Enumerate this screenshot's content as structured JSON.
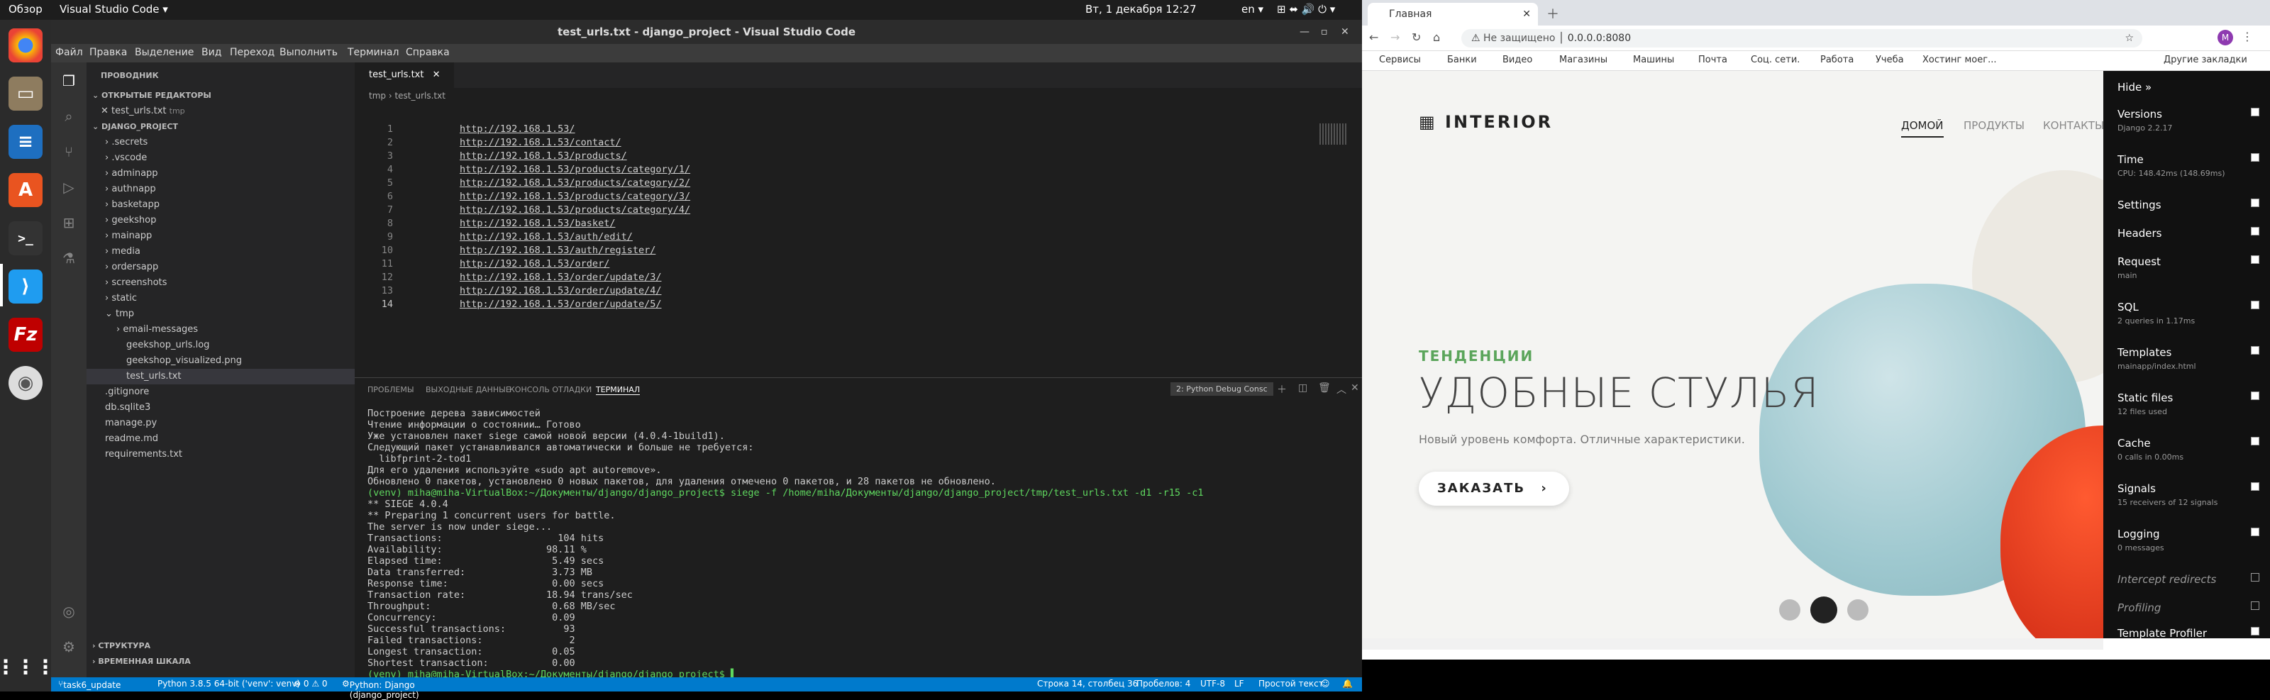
{
  "topbar": {
    "activities": "Обзор",
    "app": "Visual Studio Code ▾",
    "clock": "Вт, 1 декабря  12:27",
    "lang": "en ▾",
    "tray": "⊞ ⬌ 🔊 ⏻ ▾"
  },
  "dock": {
    "icons": [
      "chrome-icon",
      "files-icon",
      "libreoffice-writer-icon",
      "software-center-icon",
      "terminal-icon",
      "vscode-icon",
      "filezilla-icon",
      "disc-icon",
      "apps-grid-icon"
    ]
  },
  "vscode": {
    "title": "test_urls.txt - django_project - Visual Studio Code",
    "menu": [
      "Файл",
      "Правка",
      "Выделение",
      "Вид",
      "Переход",
      "Выполнить",
      "Терминал",
      "Справка"
    ],
    "sidebar": {
      "header": "ПРОВОДНИК",
      "open_editors": "ОТКРЫТЫЕ РЕДАКТОРЫ",
      "open_file": "test_urls.txt",
      "open_file_dir": "tmp",
      "project": "DJANGO_PROJECT",
      "tree": [
        ".secrets",
        ".vscode",
        "adminapp",
        "authnapp",
        "basketapp",
        "geekshop",
        "mainapp",
        "media",
        "ordersapp",
        "screenshots",
        "static",
        "tmp",
        "email-messages",
        "geekshop_urls.log",
        "geekshop_visualized.png",
        "test_urls.txt",
        ".gitignore",
        "db.sqlite3",
        "manage.py",
        "readme.md",
        "requirements.txt"
      ],
      "outline": "СТРУКТУРА",
      "timeline": "ВРЕМЕННАЯ ШКАЛА"
    },
    "tab": "test_urls.txt",
    "breadcrumb": "tmp  ›  test_urls.txt",
    "lines": [
      "http://192.168.1.53/",
      "http://192.168.1.53/contact/",
      "http://192.168.1.53/products/",
      "http://192.168.1.53/products/category/1/",
      "http://192.168.1.53/products/category/2/",
      "http://192.168.1.53/products/category/3/",
      "http://192.168.1.53/products/category/4/",
      "http://192.168.1.53/basket/",
      "http://192.168.1.53/auth/edit/",
      "http://192.168.1.53/auth/register/",
      "http://192.168.1.53/order/",
      "http://192.168.1.53/order/update/3/",
      "http://192.168.1.53/order/update/4/",
      "http://192.168.1.53/order/update/5/"
    ],
    "panel_tabs": [
      "ПРОБЛЕМЫ",
      "ВЫХОДНЫЕ ДАННЫЕ",
      "КОНСОЛЬ ОТЛАДКИ",
      "ТЕРМИНАЛ"
    ],
    "terminal_select": "2: Python Debug Consc",
    "terminal": [
      "Построение дерева зависимостей",
      "Чтение информации о состоянии… Готово",
      "Уже установлен пакет siege самой новой версии (4.0.4-1build1).",
      "Следующий пакет устанавливался автоматически и больше не требуется:",
      "  libfprint-2-tod1",
      "Для его удаления используйте «sudo apt autoremove».",
      "Обновлено 0 пакетов, установлено 0 новых пакетов, для удаления отмечено 0 пакетов, и 28 пакетов не обновлено.",
      "(venv) miha@miha-VirtualBox:~/Документы/django/django_project$ siege -f /home/miha/Документы/django/django_project/tmp/test_urls.txt -d1 -r15 -c1",
      "** SIEGE 4.0.4",
      "** Preparing 1 concurrent users for battle.",
      "The server is now under siege...",
      "Transactions:                    104 hits",
      "Availability:                  98.11 %",
      "Elapsed time:                   5.49 secs",
      "Data transferred:               3.73 MB",
      "Response time:                  0.00 secs",
      "Transaction rate:              18.94 trans/sec",
      "Throughput:                     0.68 MB/sec",
      "Concurrency:                    0.09",
      "Successful transactions:          93",
      "Failed transactions:               2",
      "Longest transaction:            0.05",
      "Shortest transaction:           0.00",
      "",
      "(venv) miha@miha-VirtualBox:~/Документы/django/django_project$ ▌"
    ],
    "status": {
      "branch": "task6_update",
      "python": "Python 3.8.5 64-bit ('venv': venv)",
      "problems": "⊗ 0 ⚠ 0",
      "debug": "Python: Django (django_project)",
      "position": "Строка 14, столбец 36",
      "spaces": "Пробелов: 4",
      "encoding": "UTF-8",
      "eol": "LF",
      "mode": "Простой текст"
    }
  },
  "browser": {
    "tab_title": "Главная",
    "url_security": "Не защищено",
    "url": "0.0.0.0:8080",
    "bookmarks": [
      "Сервисы",
      "Банки",
      "Видео",
      "Магазины",
      "Машины",
      "Почта",
      "Соц. сети.",
      "Работа",
      "Учеба",
      "Хостинг моег...",
      "Другие закладки"
    ],
    "site": {
      "logo": "INTERIOR",
      "nav": [
        "ДОМОЙ",
        "ПРОДУКТЫ",
        "КОНТАКТЫ"
      ],
      "eyebrow": "ТЕНДЕНЦИИ",
      "headline": "УДОБНЫЕ СТУЛЬЯ",
      "subtitle": "Новый уровень комфорта. Отличные характеристики.",
      "cta": "ЗАКАЗАТЬ"
    },
    "djdt": {
      "hide": "Hide »",
      "panels": [
        {
          "title": "Versions",
          "sub": "Django 2.2.17",
          "checked": true
        },
        {
          "title": "Time",
          "sub": "CPU: 148.42ms (148.69ms)",
          "checked": true
        },
        {
          "title": "Settings",
          "sub": "",
          "checked": true
        },
        {
          "title": "Headers",
          "sub": "",
          "checked": true
        },
        {
          "title": "Request",
          "sub": "main",
          "checked": true
        },
        {
          "title": "SQL",
          "sub": "2 queries in 1.17ms",
          "checked": true
        },
        {
          "title": "Templates",
          "sub": "mainapp/index.html",
          "checked": true
        },
        {
          "title": "Static files",
          "sub": "12 files used",
          "checked": true
        },
        {
          "title": "Cache",
          "sub": "0 calls in 0.00ms",
          "checked": true
        },
        {
          "title": "Signals",
          "sub": "15 receivers of 12 signals",
          "checked": true
        },
        {
          "title": "Logging",
          "sub": "0 messages",
          "checked": true
        },
        {
          "title": "Intercept redirects",
          "sub": "",
          "checked": false
        },
        {
          "title": "Profiling",
          "sub": "",
          "checked": false
        },
        {
          "title": "Template Profiler",
          "sub": "",
          "checked": true
        }
      ]
    }
  },
  "colors": {
    "accent": "#007acc",
    "brand_green": "#5ba55b",
    "djdt_bg": "#111111"
  }
}
